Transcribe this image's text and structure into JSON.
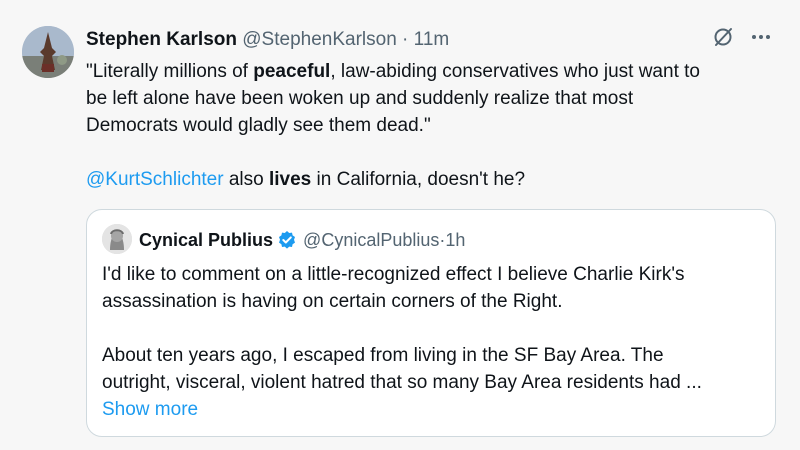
{
  "tweet": {
    "author_name": "Stephen Karlson",
    "author_handle": "@StephenKarlson",
    "separator": "·",
    "time": "11m",
    "line1_pre": "\"Literally millions of ",
    "line1_bold": "peaceful",
    "line1_post": ", law-abiding conservatives who just want to",
    "line2": "be left alone have been woken up and suddenly realize that most",
    "line3": "Democrats would gladly see them dead.\"",
    "mention": "@KurtSchlichter",
    "reply_pre": " also ",
    "reply_bold": "lives",
    "reply_post": " in California, doesn't he?",
    "more_label": "···"
  },
  "quote": {
    "author_name": "Cynical Publius",
    "author_handle": "@CynicalPublius",
    "separator": "·",
    "time": "1h",
    "para1_line1": "I'd like to comment on a little-recognized effect I believe Charlie Kirk's",
    "para1_line2": "assassination is having on certain corners of the Right.",
    "para2_line1": "About ten years ago, I escaped from living in the SF Bay Area.  The",
    "para2_line2": "outright, visceral, violent hatred that so many Bay Area residents had ...",
    "show_more": "Show more"
  },
  "colors": {
    "link": "#1d9bf0",
    "secondary_text": "#536471",
    "border": "#cfd9de"
  },
  "icons": {
    "grok": "grok-icon",
    "more": "more-icon",
    "verified": "verified-badge-icon"
  }
}
